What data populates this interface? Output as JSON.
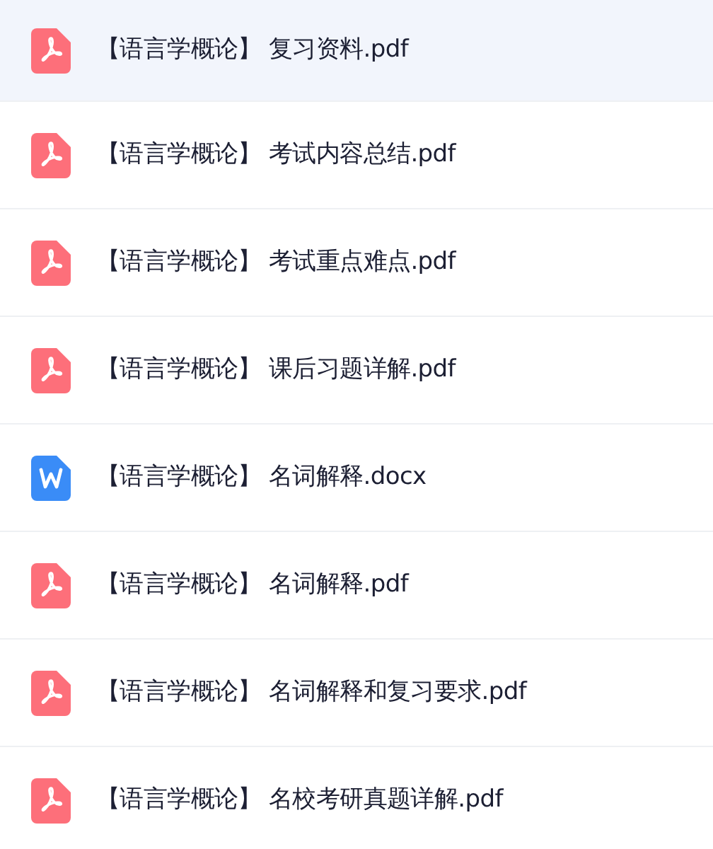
{
  "files": [
    {
      "kind": "pdf",
      "name": "【语言学概论】 复习资料.pdf",
      "selected": true
    },
    {
      "kind": "pdf",
      "name": "【语言学概论】 考试内容总结.pdf",
      "selected": false
    },
    {
      "kind": "pdf",
      "name": "【语言学概论】 考试重点难点.pdf",
      "selected": false
    },
    {
      "kind": "pdf",
      "name": "【语言学概论】 课后习题详解.pdf",
      "selected": false
    },
    {
      "kind": "word",
      "name": "【语言学概论】 名词解释.docx",
      "selected": false
    },
    {
      "kind": "pdf",
      "name": "【语言学概论】 名词解释.pdf",
      "selected": false
    },
    {
      "kind": "pdf",
      "name": "【语言学概论】 名词解释和复习要求.pdf",
      "selected": false
    },
    {
      "kind": "pdf",
      "name": "【语言学概论】 名校考研真题详解.pdf",
      "selected": false
    }
  ]
}
